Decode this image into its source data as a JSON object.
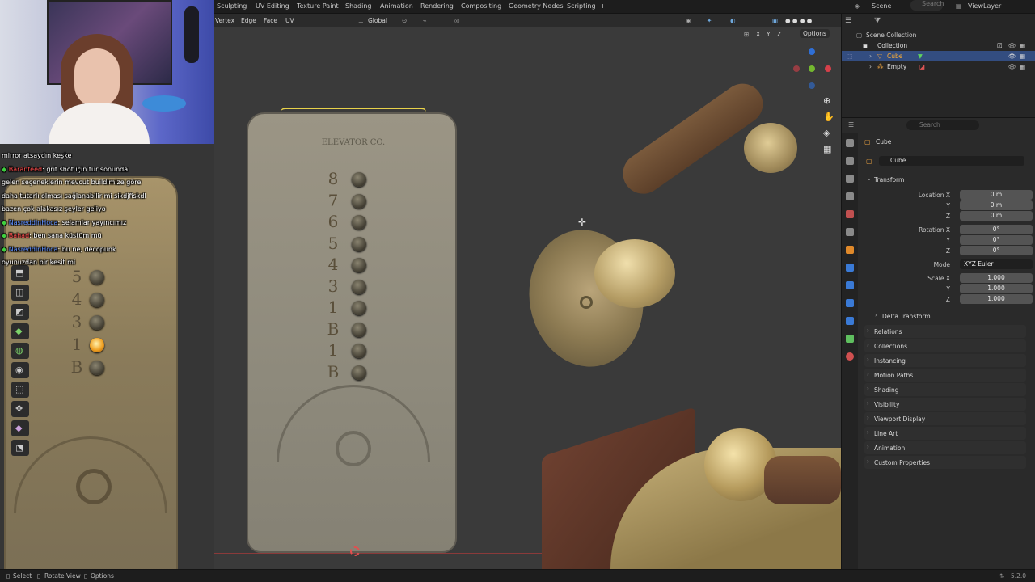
{
  "workspaces": [
    "Sculpting",
    "UV Editing",
    "Texture Paint",
    "Shading",
    "Animation",
    "Rendering",
    "Compositing",
    "Geometry Nodes",
    "Scripting",
    "+"
  ],
  "scene": {
    "name": "Scene",
    "view_layer": "ViewLayer",
    "search_placeholder": "Search"
  },
  "viewport_header": {
    "menus": [
      "Vertex",
      "Edge",
      "Face",
      "UV"
    ],
    "transform_orientation": "Global",
    "options_label": "Options",
    "axes": [
      "X",
      "Y",
      "Z"
    ]
  },
  "outliner": {
    "root": "Scene Collection",
    "collection": "Collection",
    "items": [
      {
        "name": "Cube",
        "selected": true
      },
      {
        "name": "Empty",
        "selected": false
      }
    ]
  },
  "properties": {
    "search_placeholder": "Search",
    "object_name": "Cube",
    "object_field": "Cube",
    "transform_label": "Transform",
    "location_label": "Location X",
    "location": [
      "0 m",
      "0 m",
      "0 m"
    ],
    "rotation_label": "Rotation X",
    "rotation": [
      "0°",
      "0°",
      "0°"
    ],
    "mode_label": "Mode",
    "mode_value": "XYZ Euler",
    "scale_label": "Scale X",
    "scale": [
      "1.000",
      "1.000",
      "1.000"
    ],
    "axis_y": "Y",
    "axis_z": "Z",
    "delta": "Delta Transform",
    "sections": [
      "Relations",
      "Collections",
      "Instancing",
      "Motion Paths",
      "Shading",
      "Visibility",
      "Viewport Display",
      "Line Art",
      "Animation",
      "Custom Properties"
    ]
  },
  "chat": [
    {
      "text": "mirror atsaydın keşke",
      "user": ""
    },
    {
      "user": "Baranfeed",
      "text": ": grit shot için tur sonunda"
    },
    {
      "user": "",
      "text": "gelen seçeneklerin mevcut buildimize göre"
    },
    {
      "user": "",
      "text": "daha tutarlı olması sağlanabilir mi sikdjfiskdl"
    },
    {
      "user": "",
      "text": "bazen çok alakasız şeyler geliyo"
    },
    {
      "user": "NasreddinHoca",
      "text": ": selamlar yayıncımız"
    },
    {
      "user": "Bahad",
      "text": ": ben sana küstüm mü"
    },
    {
      "user": "NasreddinHoca",
      "text": ": bu ne, decopunk"
    },
    {
      "user": "",
      "text": "oyunuzdan bir kesit mi"
    }
  ],
  "plate_numbers_left": [
    "5",
    "4",
    "3",
    "1",
    "B"
  ],
  "plate_numbers_mid": [
    "8",
    "7",
    "6",
    "5",
    "4",
    "3",
    "1",
    "B",
    "1",
    "B"
  ],
  "plate_title": "ELEVATOR CO.",
  "status": {
    "select": "Select",
    "rotate": "Rotate View",
    "options": "Options",
    "version": "5.2.0"
  }
}
